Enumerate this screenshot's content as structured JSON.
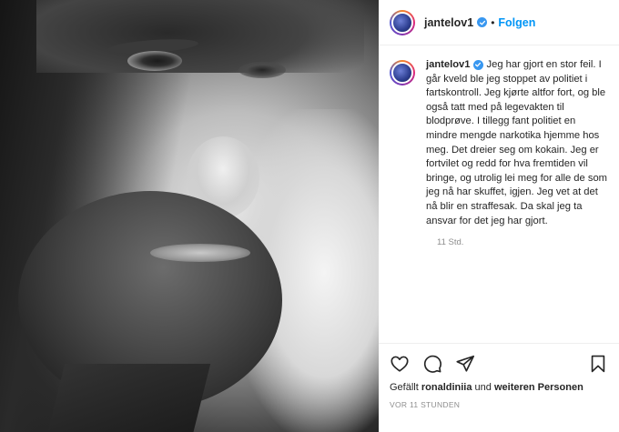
{
  "header": {
    "username": "jantelov1",
    "separator": "•",
    "follow_label": "Folgen"
  },
  "caption": {
    "username": "jantelov1",
    "text": "Jeg har gjort en stor feil. I går kveld ble jeg stoppet av politiet i fartskontroll. Jeg kjørte altfor fort, og ble også tatt med på legevakten til blodprøve. I tillegg fant politiet en mindre mengde narkotika hjemme hos meg. Det dreier seg om kokain. Jeg er fortvilet og redd for hva fremtiden vil bringe, og utrolig lei meg for alle de som jeg nå har skuffet, igjen. Jeg vet at det nå blir en straffesak. Da skal jeg ta ansvar for det jeg har gjort.",
    "time_ago": "11 Std."
  },
  "likes": {
    "prefix": "Gefällt",
    "user": "ronaldiniia",
    "connector": "und",
    "others": "weiteren Personen"
  },
  "posted": "VOR 11 STUNDEN",
  "icons": {
    "like": "heart-icon",
    "comment": "comment-icon",
    "share": "paper-plane-icon",
    "save": "bookmark-icon",
    "verified": "verified-badge-icon"
  },
  "colors": {
    "accent": "#0095f6",
    "verified": "#3897f0",
    "text": "#262626",
    "muted": "#8e8e8e"
  }
}
